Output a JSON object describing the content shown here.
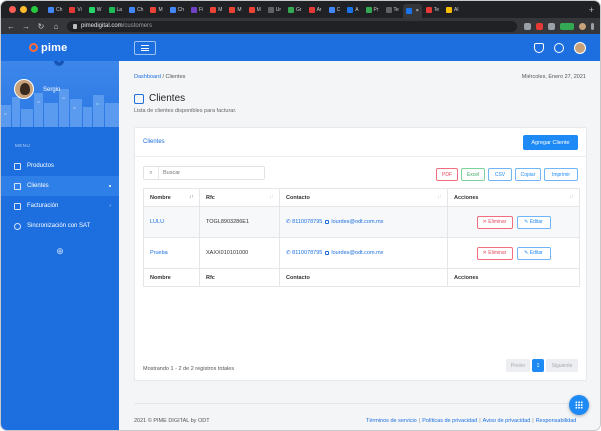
{
  "browser": {
    "url_host": "pimedigital.com",
    "url_path": "/customers",
    "tabs": [
      {
        "label": "Ch",
        "color": "#4285f4"
      },
      {
        "label": "Vi",
        "color": "#e53935"
      },
      {
        "label": "W",
        "color": "#25d366"
      },
      {
        "label": "La",
        "color": "#1db954"
      },
      {
        "label": "Ch",
        "color": "#4285f4"
      },
      {
        "label": "M",
        "color": "#ea4335"
      },
      {
        "label": "Ch",
        "color": "#4285f4"
      },
      {
        "label": "Fi",
        "color": "#6f42c1"
      },
      {
        "label": "M",
        "color": "#ea4335"
      },
      {
        "label": "M",
        "color": "#ea4335"
      },
      {
        "label": "M",
        "color": "#ea4335"
      },
      {
        "label": "Ur",
        "color": "#5f6368"
      },
      {
        "label": "Gr",
        "color": "#34a853"
      },
      {
        "label": "Ar",
        "color": "#e53935"
      },
      {
        "label": "C",
        "color": "#4285f4"
      },
      {
        "label": "A",
        "color": "#1a73e8"
      },
      {
        "label": "Pr",
        "color": "#34a853"
      },
      {
        "label": "Te",
        "color": "#5f6368"
      },
      {
        "label": "",
        "color": "#1a73e8",
        "active": true
      },
      {
        "label": "Te",
        "color": "#e53935"
      },
      {
        "label": "Al",
        "color": "#fbbc05"
      }
    ]
  },
  "brand": {
    "name": "pime"
  },
  "sidebar": {
    "user_name": "Sergio",
    "menu_title": "MENU",
    "items": [
      {
        "label": "Productos",
        "icon": "box-icon",
        "active": false
      },
      {
        "label": "Clientes",
        "icon": "users-icon",
        "active": true
      },
      {
        "label": "Facturación",
        "icon": "invoice-icon",
        "active": false,
        "has_submenu": true
      },
      {
        "label": "Sincronización con SAT",
        "icon": "sync-icon",
        "active": false
      }
    ]
  },
  "header": {
    "breadcrumb_root": "Dashboard",
    "breadcrumb_sep": "/",
    "breadcrumb_current": "Clientes",
    "date": "Miércoles, Enero 27, 2021"
  },
  "page": {
    "title": "Clientes",
    "subtitle": "Lista de clientes disponibles para facturar."
  },
  "card": {
    "title": "Clientes",
    "add_button": "Agregar Cliente",
    "search_placeholder": "Buscar",
    "exports": {
      "pdf": "PDF",
      "excel": "Excel",
      "csv": "CSV",
      "copy": "Copiar",
      "print": "Imprimir"
    },
    "columns": [
      "Nombre",
      "Rfc",
      "Contacto",
      "Acciones"
    ],
    "rows": [
      {
        "name": "LULU",
        "rfc": "TOGL8903286E1",
        "phone": "8110078795",
        "email": "lourdes@odt.com.mx",
        "delete": "Eliminar",
        "edit": "Editar"
      },
      {
        "name": "Prueba",
        "rfc": "XAXX010101000",
        "phone": "8110078795",
        "email": "lourdes@odt.com.mx",
        "delete": "Eliminar",
        "edit": "Editar"
      }
    ],
    "info": "Mostrando 1 - 2 de 2 registros totales",
    "pager": {
      "prev": "Previo",
      "current": "1",
      "next": "Siguiente"
    }
  },
  "footer": {
    "copyright": "2021 © PIME DIGITAL by ODT",
    "links": [
      "Términos de servicio",
      "Políticas de privacidad",
      "Aviso de privacidad",
      "Responsabilidad"
    ]
  },
  "colors": {
    "primary": "#1d6fe0",
    "accent": "#1d8af5",
    "danger": "#e84a5f",
    "success": "#3aa864"
  }
}
